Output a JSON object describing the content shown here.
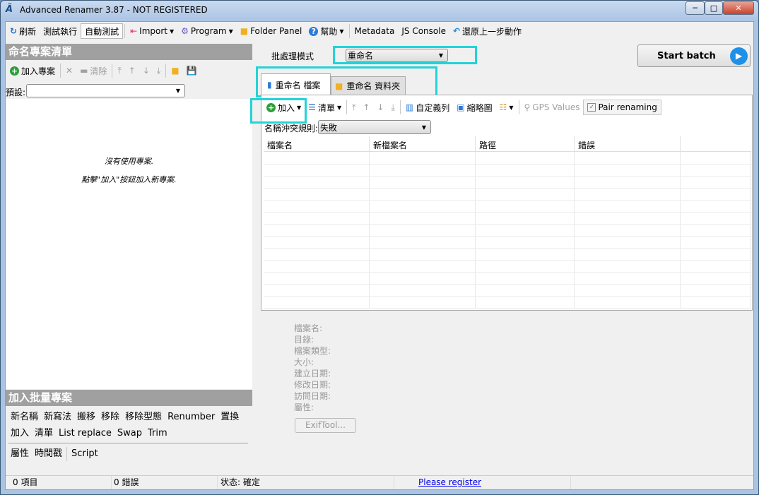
{
  "window": {
    "title": "Advanced Renamer 3.87 - NOT REGISTERED",
    "minimize": "─",
    "maximize": "□",
    "close": "✕"
  },
  "toolbar": {
    "refresh": "刷新",
    "test_run": "測試執行",
    "auto_test": "自動測試",
    "import": "Import",
    "program": "Program",
    "folder_panel": "Folder Panel",
    "help": "幫助",
    "metadata": "Metadata",
    "js_console": "JS Console",
    "undo": "還原上一步動作"
  },
  "left": {
    "header": "命名專案清單",
    "add_method": "加入專案",
    "clear": "清除",
    "preset_label": "預設:",
    "preset_value": "",
    "empty_line1": "沒有使用專案.",
    "empty_line2": "點擊\"加入\"按鈕加入新專案.",
    "batch_header": "加入批量專案",
    "methods_row1": [
      "新名稱",
      "新寫法",
      "搬移",
      "移除",
      "移除型態",
      "Renumber",
      "置換"
    ],
    "methods_row2": [
      "加入",
      "清單",
      "List replace",
      "Swap",
      "Trim"
    ],
    "methods_row3": [
      "屬性",
      "時間戳"
    ],
    "script": "Script"
  },
  "batch": {
    "mode_label": "批處理模式",
    "mode_value": "重命名",
    "start": "Start batch"
  },
  "tabs": [
    {
      "label": "重命名 檔案"
    },
    {
      "label": "重命名 資料夾"
    }
  ],
  "files": {
    "add": "加入",
    "list": "清單",
    "columns_btn": "自定義列",
    "thumbnails": "縮略圖",
    "gps": "GPS Values",
    "pair": "Pair renaming",
    "conflict_label": "名稱沖突規則:",
    "conflict_value": "失敗",
    "columns": [
      "檔案名",
      "新檔案名",
      "路徑",
      "錯誤"
    ]
  },
  "info": {
    "labels": [
      "檔案名:",
      "目錄:",
      "檔案類型:",
      "大小:",
      "建立日期:",
      "修改日期:",
      "訪問日期:",
      "屬性:"
    ],
    "exiftool": "ExifTool..."
  },
  "status": {
    "items": "0 項目",
    "errors": "0 錯誤",
    "state": "状态: 確定",
    "register": "Please register"
  },
  "colors": {
    "highlight": "#22d3d8",
    "header_gray": "#a0a0a0",
    "start_icon": "#1e90e8"
  }
}
